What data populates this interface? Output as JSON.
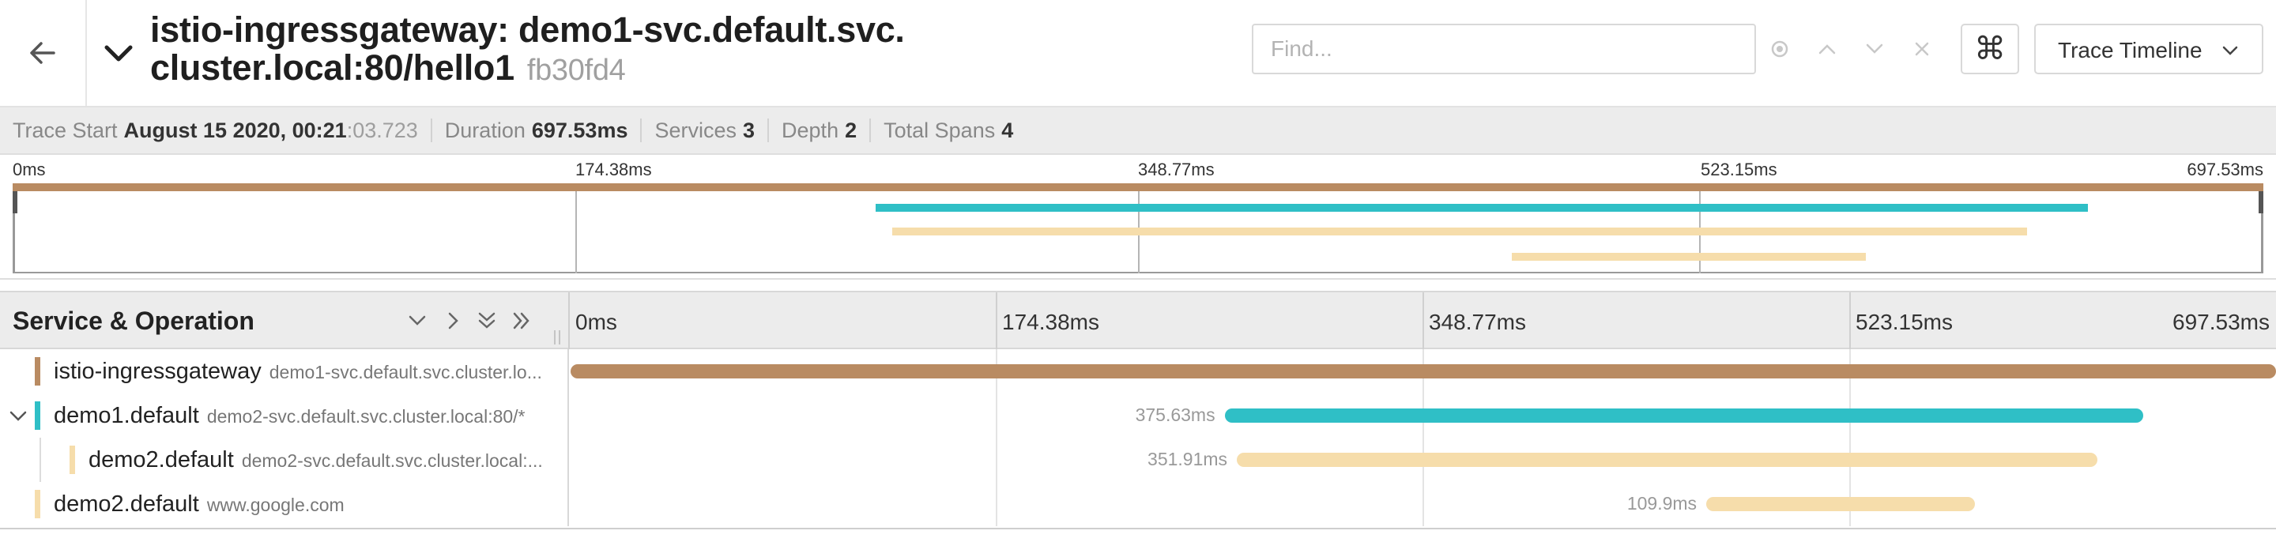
{
  "header": {
    "back_icon": "arrow-left-icon",
    "collapse_icon": "chevron-down-icon",
    "title_line1": "istio-ingressgateway: demo1-svc.default.svc.",
    "title_line2": "cluster.local:80/hello1",
    "trace_id": "fb30fd4",
    "find_placeholder": "Find...",
    "find_value": "",
    "find_icons": [
      "locate-icon",
      "chevron-up-icon",
      "chevron-down-icon",
      "close-icon"
    ],
    "shortcut_icon": "command-key-icon",
    "shortcut_glyph": "⌘",
    "view_select": "Trace Timeline"
  },
  "summary": {
    "trace_start_label": "Trace Start",
    "trace_start_value": "August 15 2020, 00:21",
    "trace_start_ms": ":03.723",
    "duration_label": "Duration",
    "duration_value": "697.53ms",
    "services_label": "Services",
    "services_value": "3",
    "depth_label": "Depth",
    "depth_value": "2",
    "total_spans_label": "Total Spans",
    "total_spans_value": "4"
  },
  "minimap": {
    "ticks": [
      "0ms",
      "174.38ms",
      "348.77ms",
      "523.15ms",
      "697.53ms"
    ]
  },
  "timeline": {
    "left_title": "Service & Operation",
    "controls": [
      "chevron-down-icon",
      "chevron-right-icon",
      "double-chevron-down-icon",
      "double-chevron-right-icon"
    ],
    "ticks": [
      "0ms",
      "174.38ms",
      "348.77ms",
      "523.15ms",
      "697.53ms"
    ]
  },
  "total_duration_ms": 697.53,
  "colors": {
    "istio": "#b98b62",
    "demo1": "#2fbfc6",
    "demo2": "#f6ddab"
  },
  "spans": [
    {
      "service": "istio-ingressgateway",
      "operation": "demo1-svc.default.svc.cluster.lo...",
      "depth": 0,
      "color": "#b98b62",
      "start_ms": 0,
      "duration_ms": 697.53,
      "duration_label": "",
      "has_toggle": false
    },
    {
      "service": "demo1.default",
      "operation": "demo2-svc.default.svc.cluster.local:80/*",
      "depth": 0,
      "color": "#2fbfc6",
      "start_ms": 267.5,
      "duration_ms": 375.63,
      "duration_label": "375.63ms",
      "has_toggle": true
    },
    {
      "service": "demo2.default",
      "operation": "demo2-svc.default.svc.cluster.local:...",
      "depth": 1,
      "color": "#f6ddab",
      "start_ms": 272.5,
      "duration_ms": 351.91,
      "duration_label": "351.91ms",
      "has_toggle": false
    },
    {
      "service": "demo2.default",
      "operation": "www.google.com",
      "depth": 0,
      "color": "#f6ddab",
      "start_ms": 464.5,
      "duration_ms": 109.9,
      "duration_label": "109.9ms",
      "has_toggle": false
    }
  ]
}
